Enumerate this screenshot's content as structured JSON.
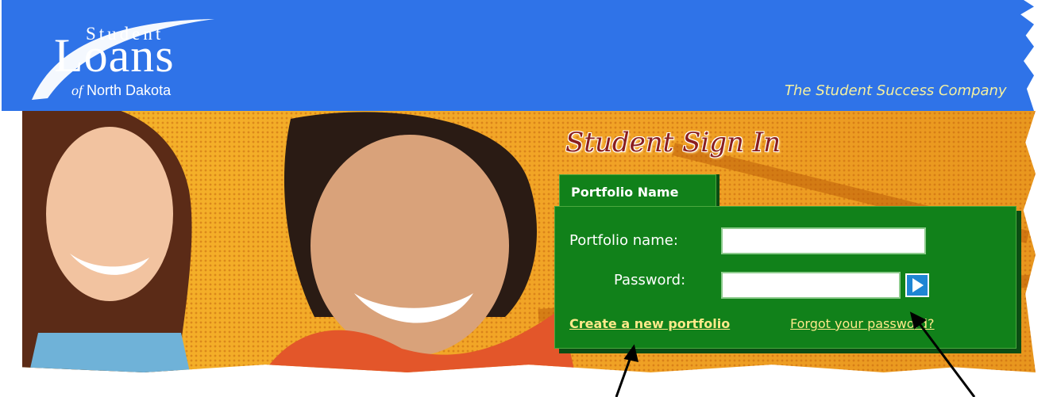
{
  "header": {
    "logo": {
      "line1": "Student",
      "line2": "Loans",
      "line3_prefix": "of",
      "line3": "North Dakota"
    },
    "tagline": "The Student Success Company",
    "background_color": "#2f73e8"
  },
  "signin": {
    "title": "Student Sign In",
    "tab_label": "Portfolio Name",
    "portfolio_label": "Portfolio name:",
    "portfolio_value": "",
    "password_label": "Password:",
    "password_value": "",
    "submit_icon": "play-arrow-icon",
    "create_link": "Create a new portfolio",
    "forgot_link": "Forgot your password?",
    "panel_color": "#11811a",
    "title_color": "#8a1e1e"
  },
  "annotations": {
    "arrow_color": "#000000",
    "targets": [
      "create-portfolio-link",
      "forgot-password-link"
    ]
  }
}
